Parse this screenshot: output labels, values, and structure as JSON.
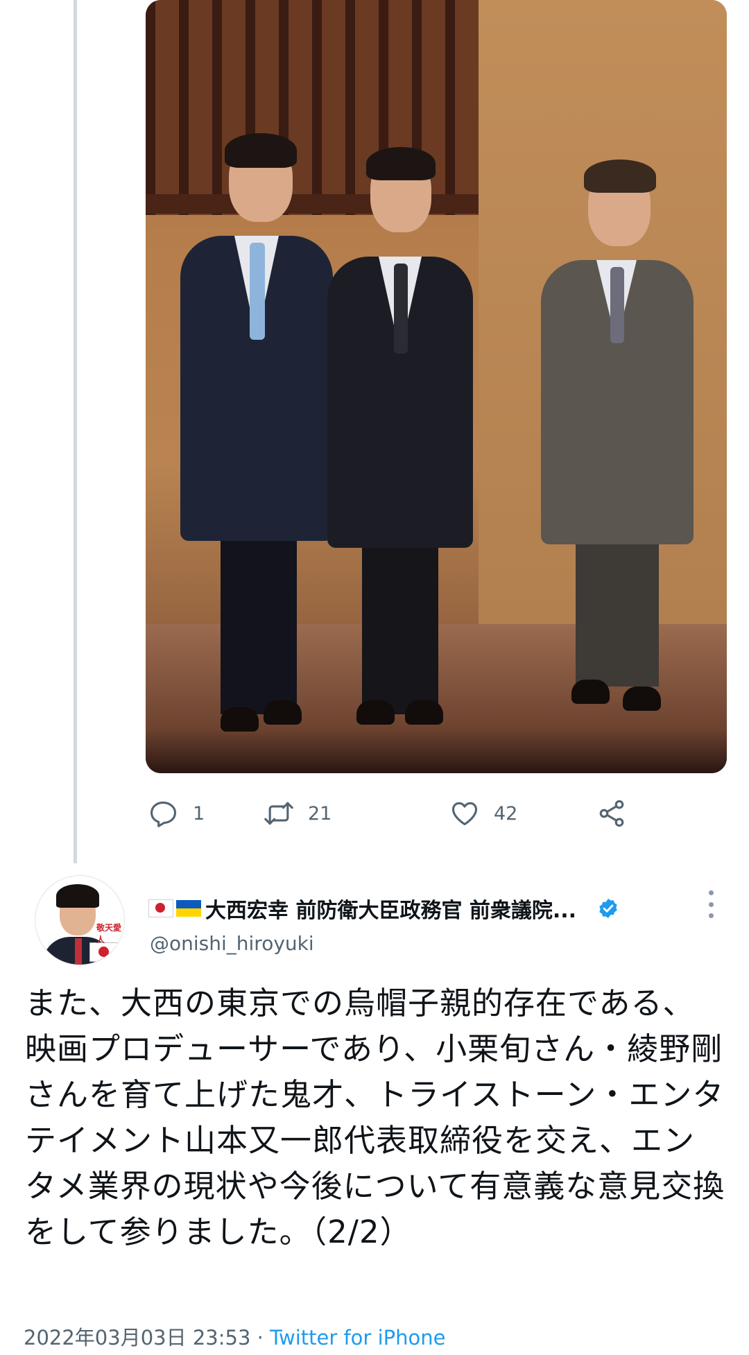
{
  "tweet": {
    "reply_count": "1",
    "retweet_count": "21",
    "like_count": "42",
    "display_name": "大西宏幸 前防衛大臣政務官 前衆議院...",
    "handle": "@onishi_hiroyuki",
    "avatar_text": "敬天愛人",
    "text": "また、大西の東京での烏帽子親的存在である、映画プロデューサーであり、小栗旬さん・綾野剛さんを育て上げた鬼才、トライストーン・エンタテイメント山本又一郎代表取締役を交え、エンタメ業界の現状や今後について有意義な意見交換をして参りました。（2/2）",
    "timestamp": "2022年03月03日 23:53",
    "separator": " · ",
    "source": "Twitter for iPhone"
  },
  "icons": {
    "reply": "reply-icon",
    "retweet": "retweet-icon",
    "like": "heart-icon",
    "share": "share-icon",
    "verified": "verified-badge-icon",
    "more": "more-options-icon"
  },
  "colors": {
    "link": "#1d9bf0",
    "verified": "#1d9bf0",
    "muted": "#536471",
    "thread_line": "#cfd9de"
  }
}
